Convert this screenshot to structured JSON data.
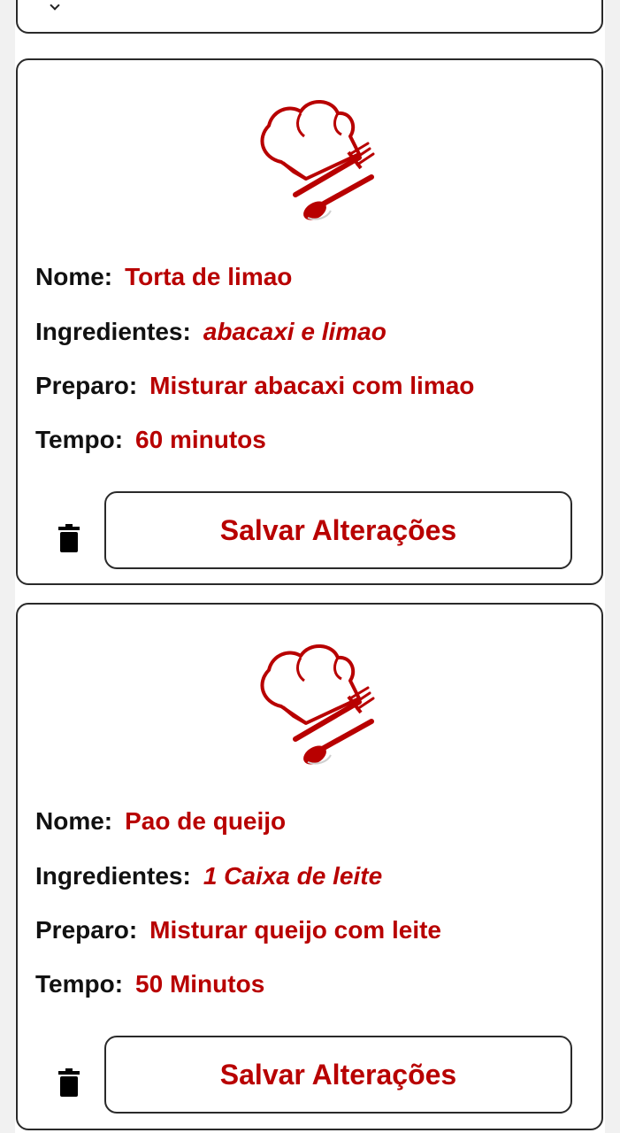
{
  "colors": {
    "accent": "#b80000",
    "label_text": "#111111",
    "border": "#2a2a2a",
    "background": "#ffffff"
  },
  "recipes": [
    {
      "icon": "chef-hat-cutlery-icon",
      "name_label": "Nome:",
      "name": "Torta de limao",
      "ingredients_label": "Ingredientes:",
      "ingredients": "abacaxi e limao",
      "preparation_label": "Preparo:",
      "preparation": "Misturar abacaxi com limao",
      "time_label": "Tempo:",
      "time": "60 minutos",
      "delete_icon": "trash-icon",
      "save_label": "Salvar Alterações"
    },
    {
      "icon": "chef-hat-cutlery-icon",
      "name_label": "Nome:",
      "name": "Pao de queijo",
      "ingredients_label": "Ingredientes:",
      "ingredients": "1 Caixa de leite",
      "preparation_label": "Preparo:",
      "preparation": "Misturar queijo com leite",
      "time_label": "Tempo:",
      "time": "50 Minutos",
      "delete_icon": "trash-icon",
      "save_label": "Salvar Alterações"
    }
  ]
}
